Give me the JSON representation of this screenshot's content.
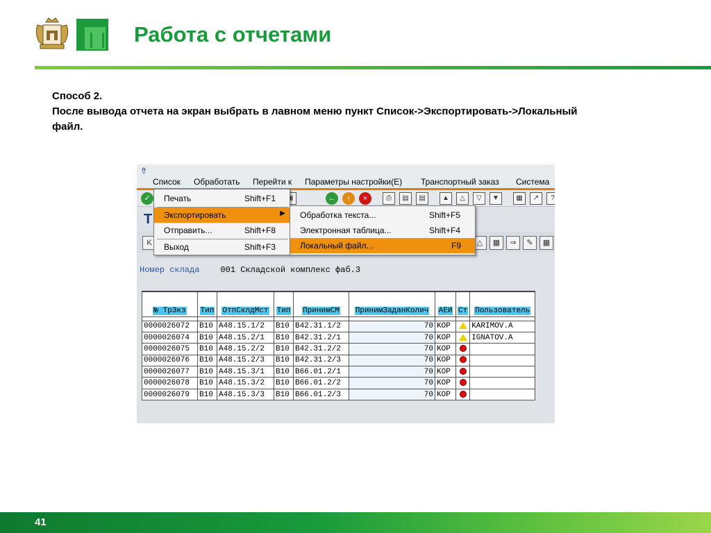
{
  "slide": {
    "title": "Работа с отчетами",
    "page_number": "41",
    "body_lines": [
      "Способ 2.",
      "После вывода отчета на экран выбрать в лавном меню пункт Список->Экспортировать->Локальный",
      "файл."
    ],
    "colors": {
      "accent_green": "#199b3b",
      "highlight_orange": "#f0900f",
      "header_cyan": "#4fc6ec"
    }
  },
  "sap": {
    "menubar": [
      {
        "label": "Список"
      },
      {
        "label": "Обработать"
      },
      {
        "label": "Перейти к"
      },
      {
        "label": "Параметры настройки(Е)"
      },
      {
        "label": "Транспортный заказ"
      },
      {
        "label": "Система"
      }
    ],
    "app_title": "Т",
    "field": {
      "label": "Номер склада",
      "value": "001 Складской комплекс фаб.3"
    },
    "menu_list": [
      {
        "label": "Печать",
        "shortcut": "Shift+F1"
      },
      {
        "label": "Экспортировать",
        "shortcut": ""
      },
      {
        "label": "Отправить...",
        "shortcut": "Shift+F8"
      },
      {
        "label": "Выход",
        "shortcut": "Shift+F3"
      }
    ],
    "menu_export": [
      {
        "label": "Обработка текста...",
        "shortcut": "Shift+F5"
      },
      {
        "label": "Электронная таблица...",
        "shortcut": "Shift+F4"
      },
      {
        "label": "Локальный файл...",
        "shortcut": "F9"
      }
    ],
    "table": {
      "headers": [
        "№ ТрЗкз",
        "Тип",
        "ОтпСклдМст",
        "Тип",
        "ПринимСМ",
        "ПринимЗаданКолич",
        "АЕИ",
        "Ст",
        "Пользователь"
      ],
      "rows": [
        [
          "0000026072",
          "B10",
          "A48.15.1/2",
          "B10",
          "B42.31.1/2",
          "70",
          "KOP",
          "warning",
          "KARIMOV.A"
        ],
        [
          "0000026074",
          "B10",
          "A48.15.2/1",
          "B10",
          "B42.31.2/1",
          "70",
          "KOP",
          "warning",
          "IGNATOV.A"
        ],
        [
          "0000026075",
          "B10",
          "A48.15.2/2",
          "B10",
          "B42.31.2/2",
          "70",
          "KOP",
          "error",
          ""
        ],
        [
          "0000026076",
          "B10",
          "A48.15.2/3",
          "B10",
          "B42.31.2/3",
          "70",
          "KOP",
          "error",
          ""
        ],
        [
          "0000026077",
          "B10",
          "A48.15.3/1",
          "B10",
          "B66.01.2/1",
          "70",
          "KOP",
          "error",
          ""
        ],
        [
          "0000026078",
          "B10",
          "A48.15.3/2",
          "B10",
          "B66.01.2/2",
          "70",
          "KOP",
          "error",
          ""
        ],
        [
          "0000026079",
          "B10",
          "A48.15.3/3",
          "B10",
          "B66.01.2/3",
          "70",
          "KOP",
          "error",
          ""
        ]
      ]
    }
  }
}
